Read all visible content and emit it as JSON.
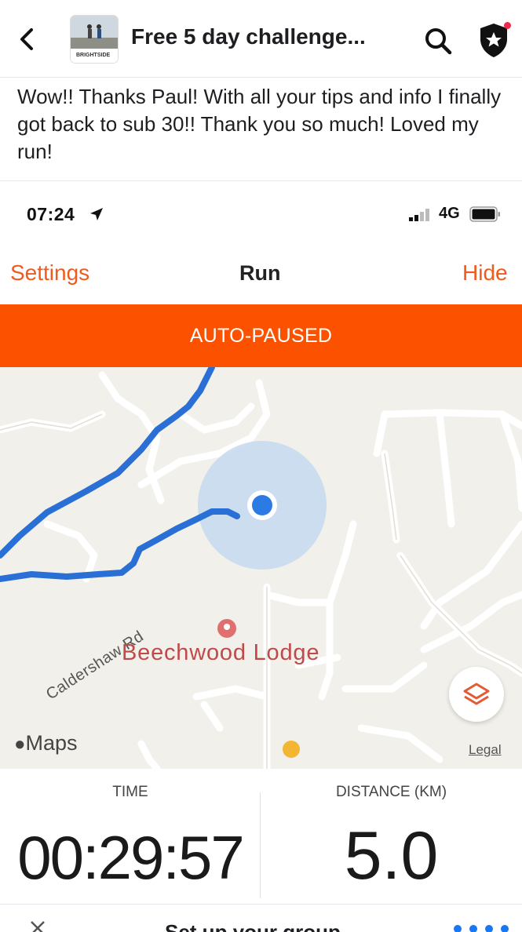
{
  "header": {
    "group_title": "Free 5 day challenge...",
    "group_thumb_text": "BRIGHTSIDE"
  },
  "post": {
    "text": "Wow!! Thanks Paul! With all your tips and info I finally got back to sub 30!! Thank you so much! Loved my run!"
  },
  "screenshot": {
    "status_bar": {
      "time": "07:24",
      "network": "4G"
    },
    "nav": {
      "left": "Settings",
      "title": "Run",
      "right": "Hide"
    },
    "banner": "AUTO-PAUSED",
    "map": {
      "road_label": "Caldershaw Rd",
      "place_label": "Beechwood Lodge",
      "maps_logo": "Maps",
      "legal": "Legal"
    },
    "stats": {
      "time_label": "TIME",
      "time_value": "00:29:57",
      "distance_label": "DISTANCE (KM)",
      "distance_value": "5.0"
    }
  },
  "bottom_bar": {
    "text": "Set up your group"
  },
  "colors": {
    "accent": "#fc5200",
    "nav_link": "#f05a1f",
    "route": "#2a6fd6",
    "place": "#c04a4a",
    "notification_dot": "#f02849"
  },
  "icons": [
    "back-arrow-icon",
    "search-icon",
    "shield-star-icon",
    "location-arrow-icon",
    "signal-icon",
    "battery-icon",
    "location-pin-icon",
    "map-layers-icon",
    "apple-icon",
    "close-icon"
  ]
}
